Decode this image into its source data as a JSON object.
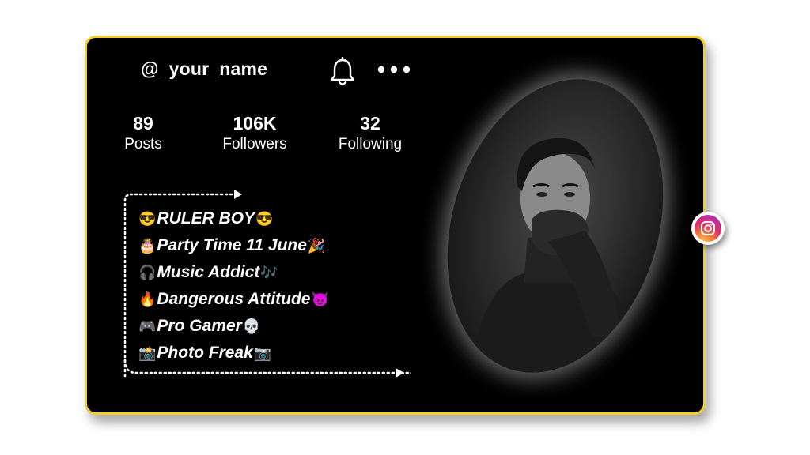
{
  "profile": {
    "username": "@_your_name",
    "stats": {
      "posts": {
        "value": "89",
        "label": "Posts"
      },
      "followers": {
        "value": "106K",
        "label": "Followers"
      },
      "following": {
        "value": "32",
        "label": "Following"
      }
    },
    "bio": [
      {
        "pre": "😎",
        "text": "RULER BOY",
        "post": "😎"
      },
      {
        "pre": "🎂",
        "text": "Party Time 11 June",
        "post": "🎉"
      },
      {
        "pre": "🎧",
        "text": "Music Addict",
        "post": "🎶"
      },
      {
        "pre": "🔥",
        "text": "Dangerous Attitude",
        "post": "😈"
      },
      {
        "pre": "🎮",
        "text": "Pro Gamer",
        "post": "💀"
      },
      {
        "pre": "📸",
        "text": "Photo Freak",
        "post": "📷"
      }
    ]
  },
  "icons": {
    "bell": "bell-icon",
    "more": "more-dots-icon",
    "instagram": "instagram-icon"
  },
  "colors": {
    "card_background": "#000000",
    "card_border": "#f2cf2e",
    "text": "#ffffff",
    "page_background": "#ffffff"
  }
}
